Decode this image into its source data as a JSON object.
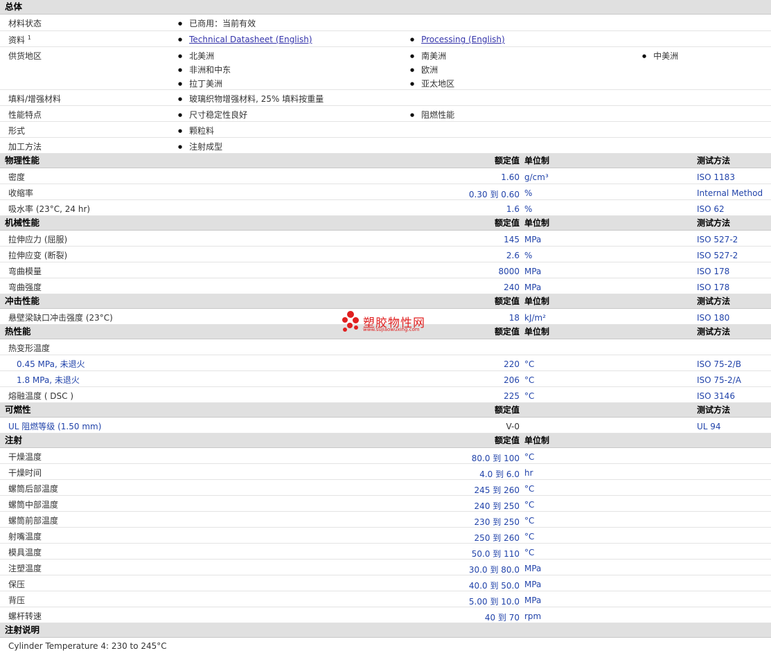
{
  "general": {
    "title": "总体",
    "rows": [
      {
        "label": "材料状态",
        "items": [
          "已商用：当前有效"
        ]
      },
      {
        "label": "资料",
        "sup": "1",
        "links": [
          "Technical Datasheet (English)",
          "Processing (English)"
        ]
      },
      {
        "label": "供货地区",
        "items": [
          "北美洲",
          "南美洲",
          "中美洲",
          "非洲和中东",
          "欧洲",
          "拉丁美洲",
          "亚太地区"
        ]
      },
      {
        "label": "填料/增强材料",
        "items": [
          "玻璃织物增强材料, 25% 填料按重量"
        ]
      },
      {
        "label": "性能特点",
        "items": [
          "尺寸稳定性良好",
          "阻燃性能"
        ]
      },
      {
        "label": "形式",
        "items": [
          "颗粒料"
        ]
      },
      {
        "label": "加工方法",
        "items": [
          "注射成型"
        ]
      }
    ]
  },
  "headers": {
    "value": "额定值",
    "unit": "单位制",
    "test": "测试方法"
  },
  "sections": [
    {
      "title": "物理性能",
      "show_unit": true,
      "show_test": true,
      "rows": [
        {
          "label": "密度",
          "value": "1.60",
          "unit": "g/cm³",
          "test": "ISO 1183"
        },
        {
          "label": "收缩率",
          "value": "0.30 到  0.60",
          "unit": "%",
          "test": "Internal Method"
        },
        {
          "label": "吸水率 (23°C, 24 hr)",
          "value": "1.6",
          "unit": "%",
          "test": "ISO 62"
        }
      ]
    },
    {
      "title": "机械性能",
      "show_unit": true,
      "show_test": true,
      "rows": [
        {
          "label": "拉伸应力 (屈服)",
          "value": "145",
          "unit": "MPa",
          "test": "ISO 527-2"
        },
        {
          "label": "拉伸应变 (断裂)",
          "value": "2.6",
          "unit": "%",
          "test": "ISO 527-2"
        },
        {
          "label": "弯曲模量",
          "value": "8000",
          "unit": "MPa",
          "test": "ISO 178"
        },
        {
          "label": "弯曲强度",
          "value": "240",
          "unit": "MPa",
          "test": "ISO 178"
        }
      ]
    },
    {
      "title": "冲击性能",
      "show_unit": true,
      "show_test": true,
      "rows": [
        {
          "label": "悬壁梁缺口冲击强度 (23°C)",
          "value": "18",
          "unit": "kJ/m²",
          "test": "ISO 180"
        }
      ]
    },
    {
      "title": "热性能",
      "show_unit": true,
      "show_test": true,
      "rows": [
        {
          "label": "热变形温度",
          "value": "",
          "unit": "",
          "test": ""
        },
        {
          "label": "0.45 MPa, 未退火",
          "indent": true,
          "value": "220",
          "unit": "°C",
          "test": "ISO 75-2/B"
        },
        {
          "label": "1.8 MPa, 未退火",
          "indent": true,
          "value": "206",
          "unit": "°C",
          "test": "ISO 75-2/A"
        },
        {
          "label": "熔融温度 ( DSC )",
          "value": "225",
          "unit": "°C",
          "test": "ISO 3146"
        }
      ]
    },
    {
      "title": "可燃性",
      "show_unit": false,
      "show_test": true,
      "rows": [
        {
          "label": "UL 阻燃等级 (1.50 mm)",
          "value": "V-0",
          "unit": "",
          "test": "UL 94"
        }
      ]
    },
    {
      "title": "注射",
      "show_unit": true,
      "show_test": false,
      "rows": [
        {
          "label": "干燥温度",
          "value": "80.0 到  100",
          "unit": "°C",
          "test": ""
        },
        {
          "label": "干燥时间",
          "value": "4.0 到  6.0",
          "unit": "hr",
          "test": ""
        },
        {
          "label": "螺筒后部温度",
          "value": "245 到  260",
          "unit": "°C",
          "test": ""
        },
        {
          "label": "螺筒中部温度",
          "value": "240 到  250",
          "unit": "°C",
          "test": ""
        },
        {
          "label": "螺筒前部温度",
          "value": "230 到  250",
          "unit": "°C",
          "test": ""
        },
        {
          "label": "射嘴温度",
          "value": "250 到  260",
          "unit": "°C",
          "test": ""
        },
        {
          "label": "模具温度",
          "value": "50.0 到  110",
          "unit": "°C",
          "test": ""
        },
        {
          "label": "注塑温度",
          "value": "30.0 到  80.0",
          "unit": "MPa",
          "test": ""
        },
        {
          "label": "保压",
          "value": "40.0 到  50.0",
          "unit": "MPa",
          "test": ""
        },
        {
          "label": "背压",
          "value": "5.00 到  10.0",
          "unit": "MPa",
          "test": ""
        },
        {
          "label": "螺杆转速",
          "value": "40 到  70",
          "unit": "rpm",
          "test": ""
        }
      ]
    }
  ],
  "notes": {
    "title": "注射说明",
    "text": "Cylinder Temperature 4: 230 to 245°C"
  },
  "watermark": {
    "text": "塑胶物性网",
    "url": "www.sujiaowuxing.com",
    "color": "#e02020"
  }
}
